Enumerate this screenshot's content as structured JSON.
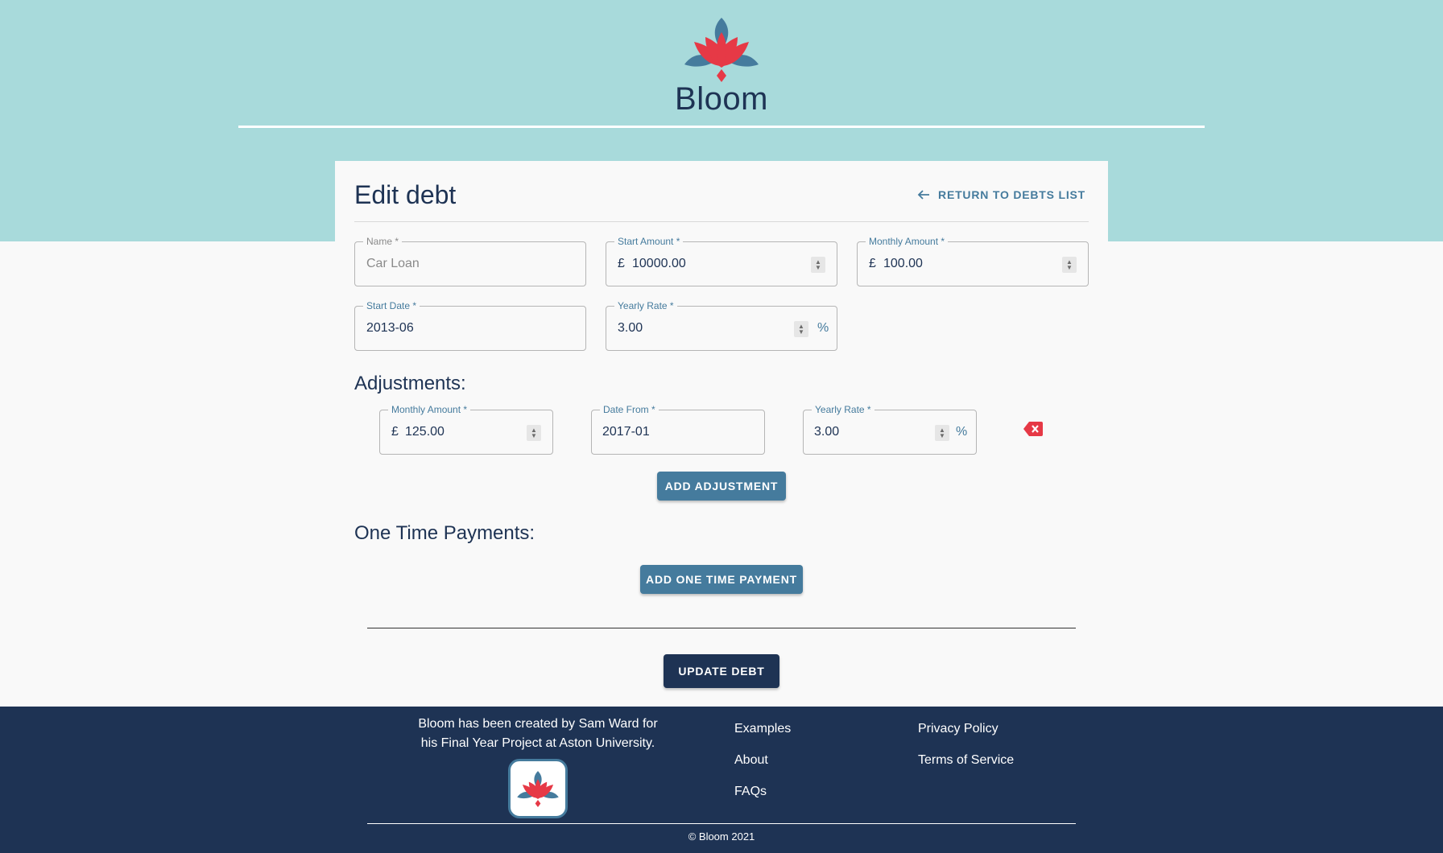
{
  "brand": {
    "name": "Bloom",
    "colors": {
      "teal": "#a8dadb",
      "navy": "#1e3354",
      "blue": "#457b9d",
      "red": "#e63946"
    }
  },
  "card": {
    "title": "Edit debt",
    "return_label": "RETURN TO DEBTS LIST"
  },
  "fields": {
    "name": {
      "label": "Name *",
      "value": "Car Loan"
    },
    "start_amount": {
      "label": "Start Amount *",
      "prefix": "£",
      "value": "10000.00"
    },
    "monthly_amount": {
      "label": "Monthly Amount *",
      "prefix": "£",
      "value": "100.00"
    },
    "start_date": {
      "label": "Start Date *",
      "value": "2013-06"
    },
    "yearly_rate": {
      "label": "Yearly Rate *",
      "value": "3.00",
      "suffix": "%"
    }
  },
  "adjustments": {
    "title": "Adjustments:",
    "items": [
      {
        "monthly_amount": {
          "label": "Monthly Amount *",
          "prefix": "£",
          "value": "125.00"
        },
        "date_from": {
          "label": "Date From *",
          "value": "2017-01"
        },
        "yearly_rate": {
          "label": "Yearly Rate *",
          "value": "3.00",
          "suffix": "%"
        }
      }
    ],
    "add_label": "ADD ADJUSTMENT"
  },
  "one_time_payments": {
    "title": "One Time Payments:",
    "add_label": "ADD ONE TIME PAYMENT"
  },
  "update_label": "UPDATE DEBT",
  "footer": {
    "about_line1": "Bloom has been created by Sam Ward for",
    "about_line2": "his Final Year Project at Aston University.",
    "links_col1": [
      "Examples",
      "About",
      "FAQs"
    ],
    "links_col2": [
      "Privacy Policy",
      "Terms of Service"
    ],
    "copyright": "© Bloom 2021"
  }
}
